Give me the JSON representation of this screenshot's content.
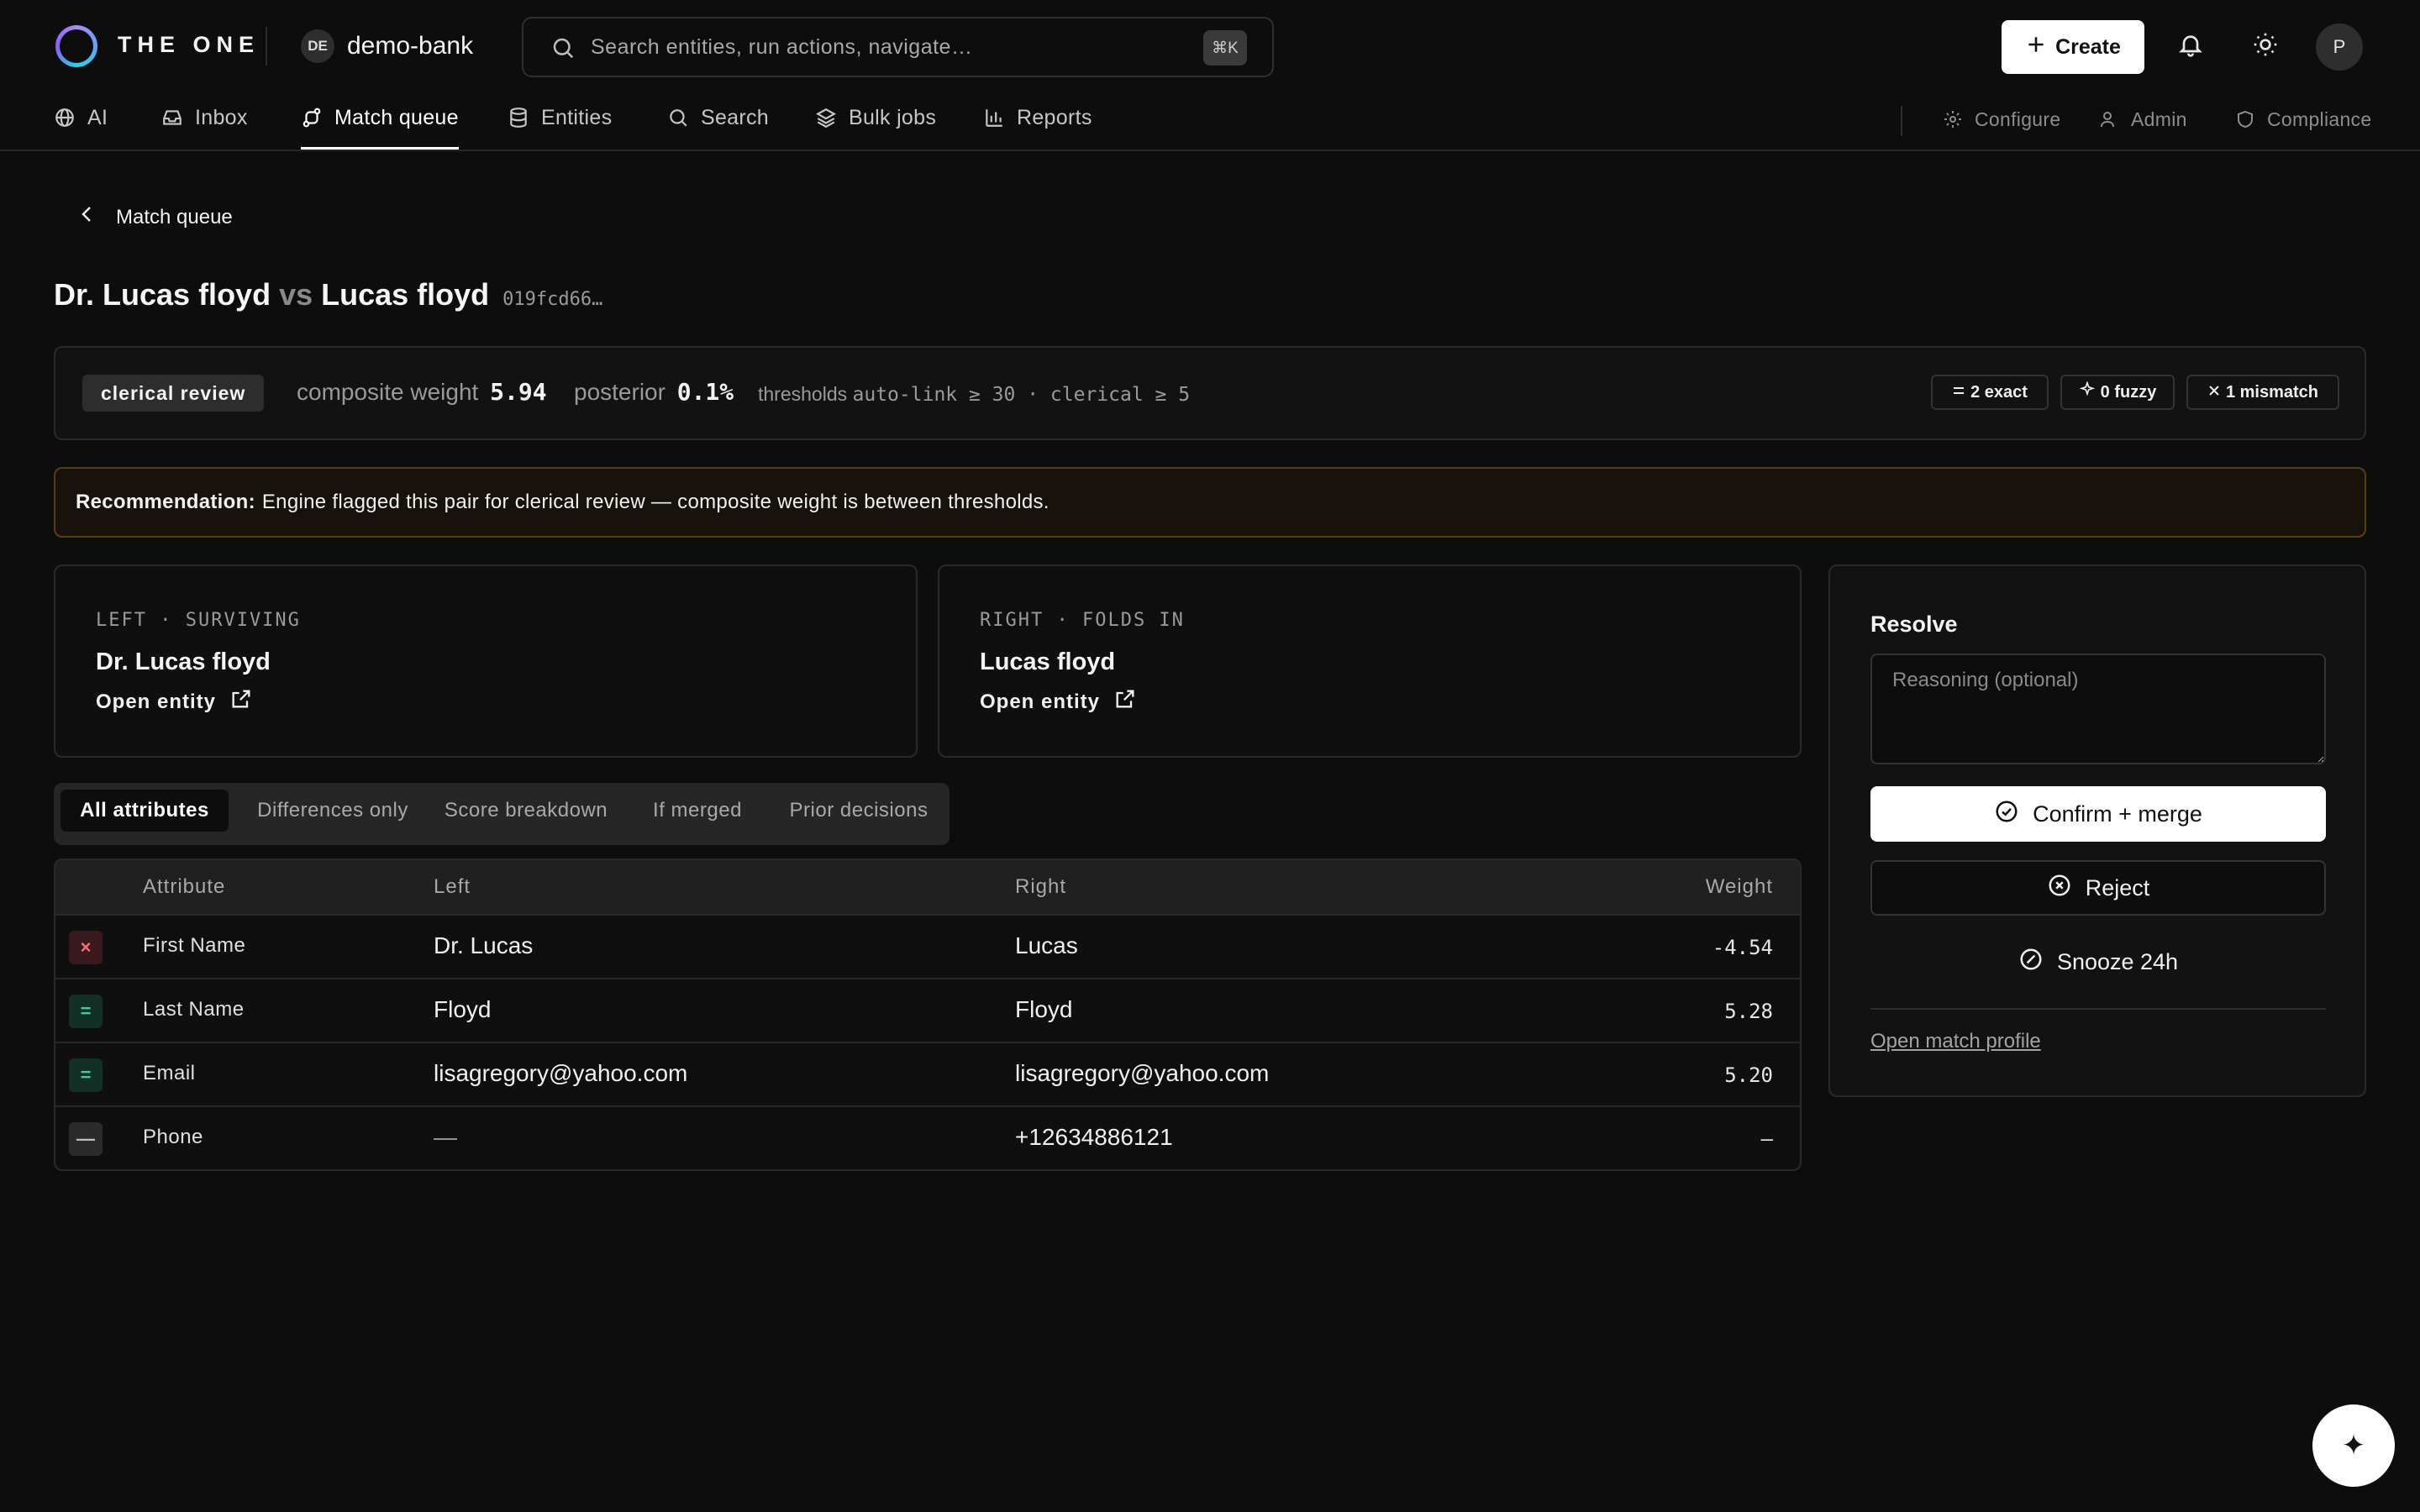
{
  "app": {
    "brand": "THE ONE",
    "workspace_initials": "DE",
    "workspace_name": "demo-bank"
  },
  "search": {
    "placeholder": "Search entities, run actions, navigate…",
    "shortcut": "⌘K"
  },
  "header": {
    "create_label": "Create",
    "avatar_initial": "P"
  },
  "nav": {
    "items": [
      {
        "label": "AI",
        "icon": "globe-icon"
      },
      {
        "label": "Inbox",
        "icon": "inbox-icon"
      },
      {
        "label": "Match queue",
        "icon": "route-icon",
        "active": true
      },
      {
        "label": "Entities",
        "icon": "database-icon"
      },
      {
        "label": "Search",
        "icon": "search-icon"
      },
      {
        "label": "Bulk jobs",
        "icon": "layers-icon"
      },
      {
        "label": "Reports",
        "icon": "bar-chart-icon"
      }
    ],
    "secondary": [
      {
        "label": "Configure",
        "icon": "gear-icon"
      },
      {
        "label": "Admin",
        "icon": "users-icon"
      },
      {
        "label": "Compliance",
        "icon": "shield-icon"
      }
    ]
  },
  "page": {
    "back_label": "Match queue",
    "left_name": "Dr. Lucas floyd",
    "vs": "vs",
    "right_name": "Lucas floyd",
    "pair_id": "019fcd66…"
  },
  "summary": {
    "status": "clerical review",
    "composite_label": "composite weight",
    "composite_value": "5.94",
    "posterior_label": "posterior",
    "posterior_value": "0.1%",
    "thresholds_label": "thresholds",
    "thresholds_value": "auto-link ≥ 30 · clerical ≥ 5",
    "chips": {
      "exact": "2 exact",
      "fuzzy": "0 fuzzy",
      "mismatch": "1 mismatch"
    }
  },
  "recommendation": {
    "label": "Recommendation:",
    "text": "Engine flagged this pair for clerical review — composite weight is between thresholds."
  },
  "left_card": {
    "label": "LEFT · SURVIVING",
    "name": "Dr. Lucas floyd",
    "open_label": "Open entity"
  },
  "right_card": {
    "label": "RIGHT · FOLDS IN",
    "name": "Lucas floyd",
    "open_label": "Open entity"
  },
  "tabs": [
    "All attributes",
    "Differences only",
    "Score breakdown",
    "If merged",
    "Prior decisions"
  ],
  "table": {
    "headers": {
      "attribute": "Attribute",
      "left": "Left",
      "right": "Right",
      "weight": "Weight"
    },
    "rows": [
      {
        "status": "mismatch",
        "status_glyph": "×",
        "attribute": "First Name",
        "left": "Dr. Lucas",
        "right": "Lucas",
        "weight": "-4.54"
      },
      {
        "status": "exact",
        "status_glyph": "=",
        "attribute": "Last Name",
        "left": "Floyd",
        "right": "Floyd",
        "weight": "5.28"
      },
      {
        "status": "exact",
        "status_glyph": "=",
        "attribute": "Email",
        "left": "lisagregory@yahoo.com",
        "right": "lisagregory@yahoo.com",
        "weight": "5.20"
      },
      {
        "status": "missing",
        "status_glyph": "—",
        "attribute": "Phone",
        "left": "—",
        "right": "+12634886121",
        "weight": "—"
      }
    ]
  },
  "resolve": {
    "title": "Resolve",
    "reasoning_placeholder": "Reasoning (optional)",
    "confirm_label": "Confirm + merge",
    "reject_label": "Reject",
    "snooze_label": "Snooze 24h",
    "profile_link": "Open match profile"
  },
  "fab_glyph": "✦"
}
